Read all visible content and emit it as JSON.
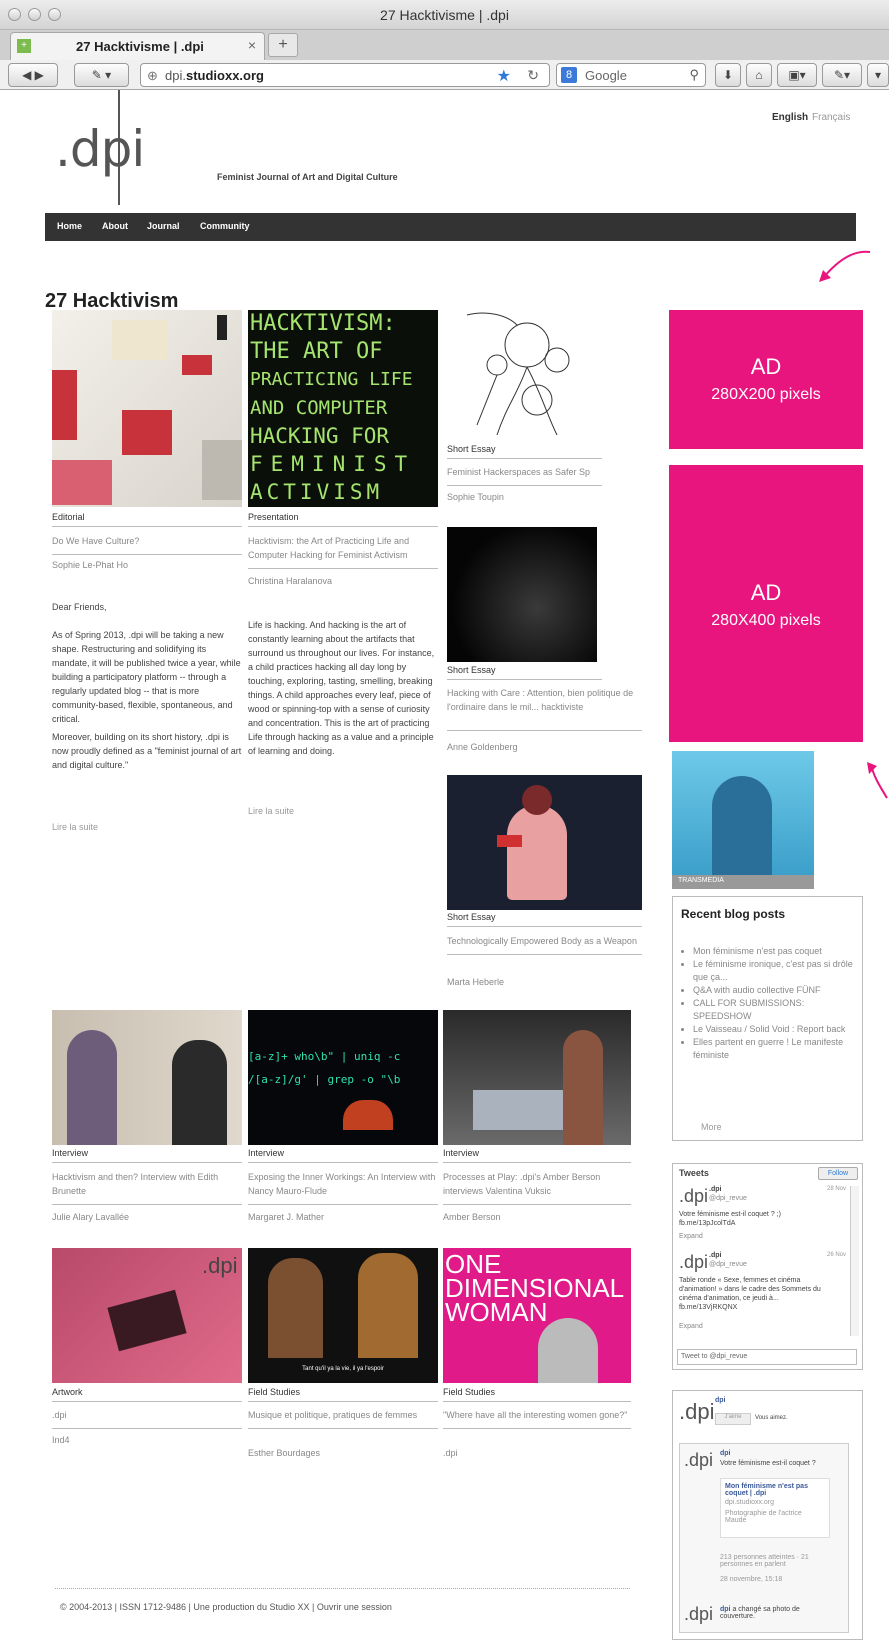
{
  "browser": {
    "window_title": "27 Hacktivisme | .dpi",
    "tab_label": "27 Hacktivisme | .dpi",
    "url_host": "dpi.",
    "url_domain": "studioxx.org",
    "search_engine": "Google"
  },
  "site": {
    "logo": ".dpi",
    "tagline": "Feminist Journal of Art and Digital Culture",
    "lang_en": "English",
    "lang_fr": "Français",
    "nav": [
      "Home",
      "About",
      "Journal",
      "Community"
    ]
  },
  "page_title": "27 Hacktivism",
  "cards": [
    {
      "category": "Editorial",
      "title": "Do We Have Culture?",
      "author": "Sophie Le-Phat Ho"
    },
    {
      "category": "Presentation",
      "title": "Hacktivism: the Art of Practicing Life and Computer Hacking for Feminist Activism",
      "author": "Christina Haralanova"
    },
    {
      "category": "Short Essay",
      "title": "Feminist Hackerspaces as Safer Sp",
      "author": "Sophie Toupin"
    },
    {
      "category": "Short Essay",
      "title": "Hacking with Care : Attention, bien politique de l'ordinaire dans le mil... hacktiviste",
      "author": "Anne Goldenberg"
    },
    {
      "category": "Short Essay",
      "title": "Technologically Empowered Body as a Weapon",
      "author": "Marta Heberle"
    },
    {
      "category": "Interview",
      "title": "Hacktivism and then? Interview with Edith Brunette",
      "author": "Julie Alary Lavallée"
    },
    {
      "category": "Interview",
      "title": "Exposing the Inner Workings: An Interview with Nancy Mauro-Flude",
      "author": "Margaret J. Mather"
    },
    {
      "category": "Interview",
      "title": "Processes at Play: .dpi's Amber Berson interviews Valentina Vuksic",
      "author": "Amber Berson"
    },
    {
      "category": "Artwork",
      "title": ".dpi",
      "author": "Ind4"
    },
    {
      "category": "Field Studies",
      "title": "Musique et politique, pratiques de femmes",
      "author": "Esther Bourdages"
    },
    {
      "category": "Field Studies",
      "title": "\"Where have all the interesting women gone?\"",
      "author": ".dpi"
    }
  ],
  "editorial_text": {
    "p1": "Dear Friends,",
    "p2": "As of Spring 2013, .dpi will be taking a new shape. Restructuring and solidifying its mandate, it will be published twice a year, while building a participatory platform -- through a regularly updated blog -- that is more community-based, flexible, spontaneous, and critical.",
    "p3": "Moreover, building on its short history, .dpi is now proudly defined as a \"feminist journal of art and digital culture.\"",
    "more": "Lire la suite"
  },
  "presentation_text": {
    "p1": "Life is hacking. And hacking is the art of constantly learning about the artifacts that surround us throughout our lives. For instance, a child practices hacking all day long by touching, exploring, tasting, smelling, breaking things. A child approaches every leaf, piece of wood or spinning-top with a sense of curiosity and concentration. This is the art of practicing Life through hacking as a value and a principle of learning and doing.",
    "more": "Lire la suite"
  },
  "hack_image_text": [
    "HACKTIVISM:",
    "THE ART OF",
    "PRACTICING LIFE",
    "AND COMPUTER",
    "HACKING FOR",
    "FEMINIST",
    "ACTIVISM"
  ],
  "terminal_text": [
    "[a-z]+ who\\b\" | uniq -c",
    "/[a-z]/g' | grep -o \"\\b"
  ],
  "one_dim_text": [
    "ONE",
    "DIMENSIONAL",
    "WOMAN"
  ],
  "subtitle_caption": "Tant qu'il ya la vie, il ya l'espoir",
  "artwork_overlay": ".dpi",
  "ads": [
    {
      "label": "AD",
      "size": "280X200 pixels"
    },
    {
      "label": "AD",
      "size": "280X400 pixels"
    }
  ],
  "sidebar": {
    "transmedia_label": "TRANSMEDIA",
    "blog_title": "Recent blog posts",
    "blog_posts": [
      "Mon féminisme n'est pas coquet",
      "Le féminisme ironique, c'est pas si drôle que ça...",
      "Q&A with audio collective FÜNF",
      "CALL FOR SUBMISSIONS: SPEEDSHOW",
      "Le Vaisseau / Solid Void : Report back",
      "Elles partent en guerre ! Le manifeste féministe"
    ],
    "blog_more": "More"
  },
  "tweets": {
    "title": "Tweets",
    "follow": "Follow",
    "items": [
      {
        "name": ".dpi",
        "handle": "@dpi_revue",
        "date": "28 Nov",
        "text": "Votre féminisme est-il coquet ? ;) fb.me/13pJcolTdA",
        "expand": "Expand"
      },
      {
        "name": ".dpi",
        "handle": "@dpi_revue",
        "date": "26 Nov",
        "text": "Table ronde « Sexe, femmes et cinéma d'animation! » dans le cadre des Sommets du cinéma d'animation, ce jeudi à... fb.me/13VjRKQNX",
        "expand": "Expand"
      }
    ],
    "input_placeholder": "Tweet to @dpi_revue"
  },
  "facebook": {
    "name": "dpi",
    "like": "J'aime",
    "vous": "Vous aimez.",
    "post1_name": "dpi",
    "post1_text": "Votre féminisme est-il coquet ?",
    "post1_link": "Mon féminisme n'est pas coquet | .dpi",
    "post1_domain": "dpi.studioxx.org",
    "post1_photo": "Photographie de l'actrice Maude",
    "post1_stats": "213 personnes atteintes · 21 personnes en parlent",
    "post1_date": "28 novembre, 15:18",
    "post2_name": "dpi",
    "post2_text": "a changé sa photo de couverture."
  },
  "footer": {
    "prefix": "© 2004-2013 | ISSN 1712-9486 | Une production du",
    "studio": "Studio XX",
    "sep": "|",
    "login": "Ouvrir une session"
  }
}
